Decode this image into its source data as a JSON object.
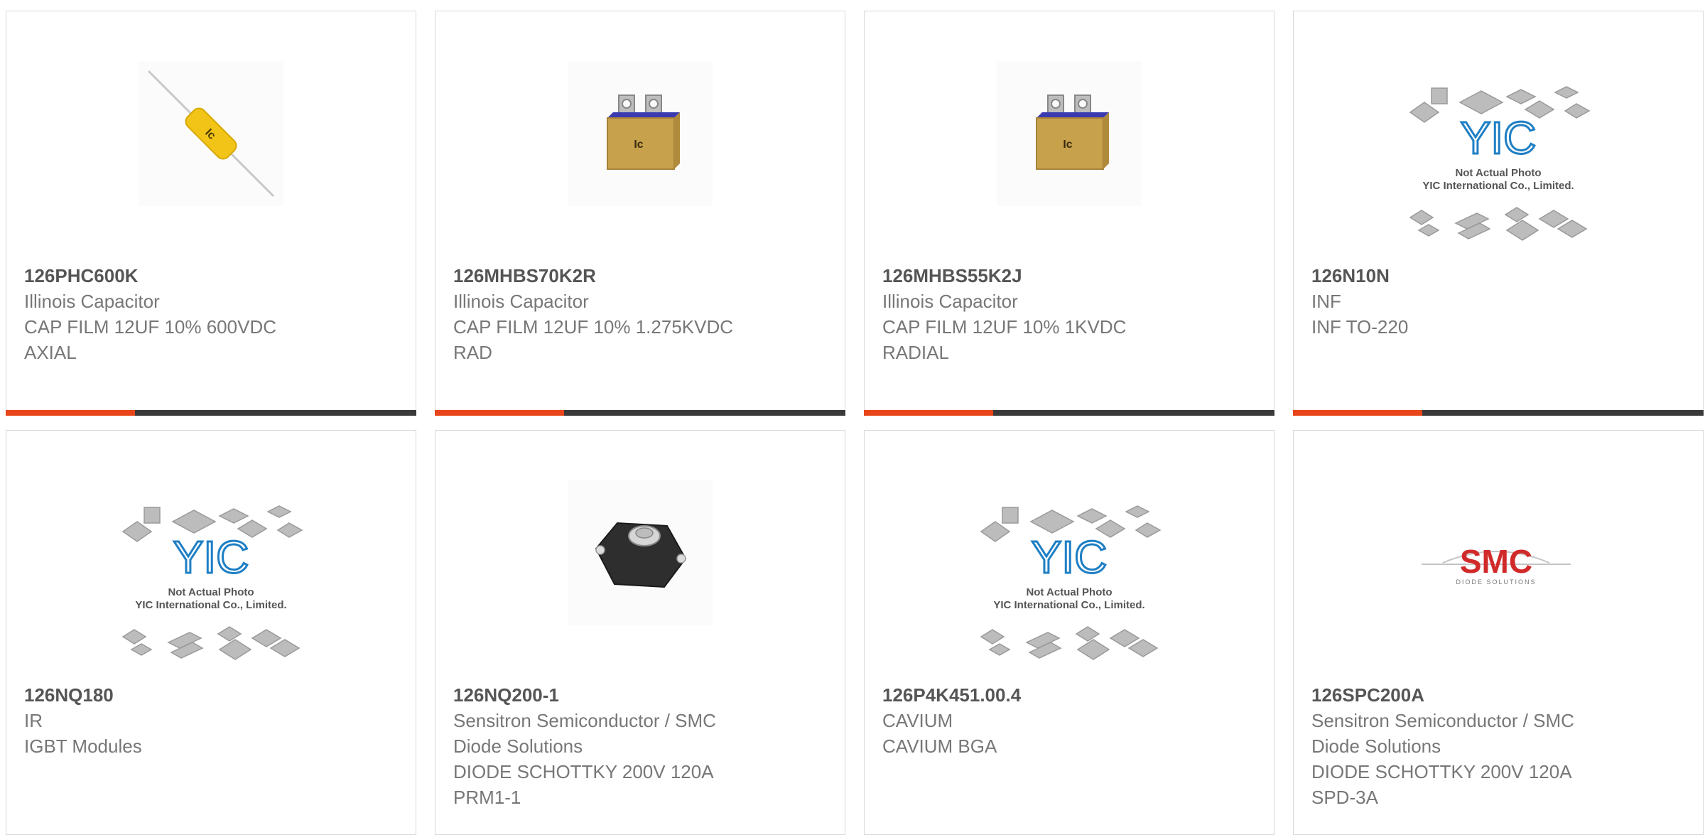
{
  "products": [
    {
      "part": "126PHC600K",
      "maker": "Illinois Capacitor",
      "desc": "CAP FILM 12UF 10% 600VDC AXIAL",
      "image": "axial-capacitor",
      "show_bar": true
    },
    {
      "part": "126MHBS70K2R",
      "maker": "Illinois Capacitor",
      "desc": "CAP FILM 12UF 10% 1.275KVDC RAD",
      "image": "box-capacitor",
      "show_bar": true
    },
    {
      "part": "126MHBS55K2J",
      "maker": "Illinois Capacitor",
      "desc": "CAP FILM 12UF 10% 1KVDC RADIAL",
      "image": "box-capacitor",
      "show_bar": true
    },
    {
      "part": "126N10N",
      "maker": "INF",
      "desc": "INF TO-220",
      "image": "yic-placeholder",
      "show_bar": true
    },
    {
      "part": "126NQ180",
      "maker": "IR",
      "desc": "IGBT Modules",
      "image": "yic-placeholder",
      "show_bar": false
    },
    {
      "part": "126NQ200-1",
      "maker": "Sensitron Semiconductor / SMC Diode Solutions",
      "desc": "DIODE SCHOTTKY 200V 120A PRM1-1",
      "image": "diode-module",
      "show_bar": false
    },
    {
      "part": "126P4K451.00.4",
      "maker": "CAVIUM",
      "desc": "CAVIUM BGA",
      "image": "yic-placeholder",
      "show_bar": false
    },
    {
      "part": "126SPC200A",
      "maker": "Sensitron Semiconductor / SMC Diode Solutions",
      "desc": "DIODE SCHOTTKY 200V 120A SPD-3A",
      "image": "smc-logo",
      "show_bar": false
    }
  ],
  "placeholder": {
    "line1": "Not Actual Photo",
    "line2": "YIC International Co., Limited.",
    "logo": "YIC"
  },
  "smc": {
    "logo": "SMC",
    "tagline": "DIODE SOLUTIONS"
  },
  "colors": {
    "accent": "#e8461a",
    "bar": "#3a3a3a",
    "part_text": "#555555",
    "body_text": "#777777"
  }
}
